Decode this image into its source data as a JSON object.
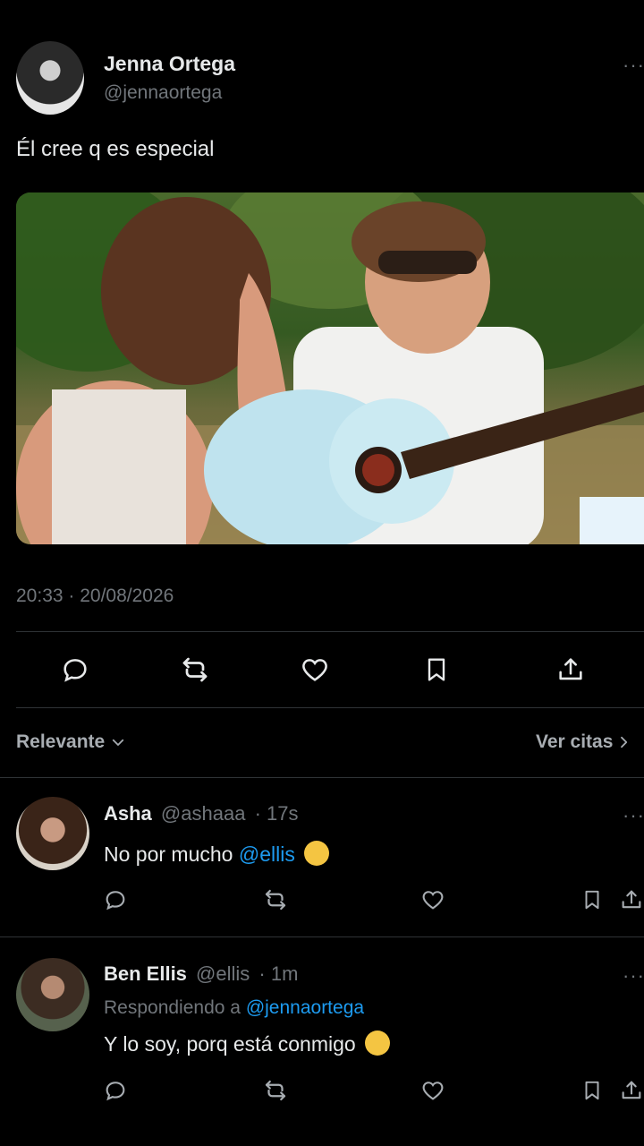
{
  "tweet": {
    "author_name": "Jenna Ortega",
    "author_handle": "@jennaortega",
    "text": "Él cree q es especial",
    "timestamp": "20:33 · 20/08/2026",
    "more_icon": "more-dots-icon"
  },
  "actions": {
    "reply_icon": "reply-icon",
    "retweet_icon": "retweet-icon",
    "like_icon": "heart-icon",
    "bookmark_icon": "bookmark-icon",
    "share_icon": "share-icon"
  },
  "sort": {
    "label": "Relevante",
    "quotes_label": "Ver citas"
  },
  "replies": [
    {
      "name": "Asha",
      "handle": "@ashaaa",
      "time": "· 17s",
      "text_prefix": "No por mucho",
      "mention": "@ellis",
      "emoji": "zany-face-emoji"
    },
    {
      "name": "Ben Ellis",
      "handle": "@ellis",
      "time": "· 1m",
      "replying_prefix": "Respondiendo a",
      "replying_to": "@jennaortega",
      "text": "Y lo soy, porq está conmigo",
      "emoji": "smirking-face-emoji"
    }
  ],
  "colors": {
    "background": "#000000",
    "text": "#e7e9ea",
    "muted": "#71767b",
    "link": "#1d9bf0",
    "divider": "#2f3336"
  }
}
